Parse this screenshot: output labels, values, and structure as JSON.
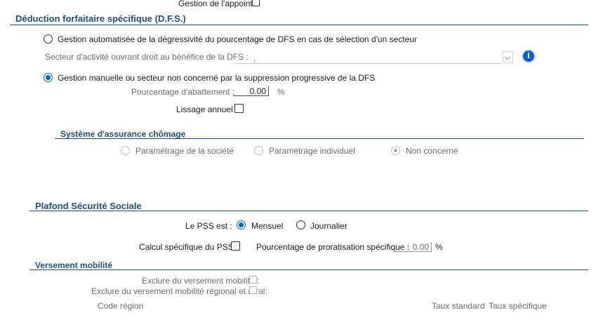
{
  "top": {
    "appoint_label": "Gestion de l'appoint :"
  },
  "dfs": {
    "title": "Déduction forfaitaire spécifique (D.F.S.)",
    "option_auto": "Gestion automatisée de la dégressivité du pourcentage de DFS en cas de sélection d'un secteur",
    "secteur_label": "Secteur d'activité ouvrant droit au bénéfice de la DFS :",
    "secteur_value": "",
    "info_icon": "i",
    "option_manual": "Gestion manuelle ou secteur non concerné par la suppression progressive de la DFS",
    "abattement_label": "Pourcentage d'abattement :",
    "abattement_value": "0.00",
    "abattement_unit": "%",
    "lissage_label": "Lissage annuel :"
  },
  "chomage": {
    "title": "Système d'assurance chômage",
    "options": [
      "Paramétrage de la société",
      "Paramétrage individuel",
      "Non concerné"
    ]
  },
  "pss": {
    "title": "Plafond Sécurité Sociale",
    "pss_label": "Le PSS est :",
    "opt_mensuel": "Mensuel",
    "opt_journalier": "Journalier",
    "calcul_label": "Calcul spécifique du PSS :",
    "proratisation_label": "Pourcentage de proratisation spécifique :",
    "proratisation_value": "0.00",
    "proratisation_unit": "%"
  },
  "mobilite": {
    "title": "Versement mobilité",
    "exclure_label": "Exclure du versement mobilité :",
    "exclure_regional_label": "Exclure du versement mobilité régional et rural:",
    "col_code_region": "Code région",
    "col_taux_standard": "Taux standard",
    "col_taux_specifique": "Taux spécifique"
  },
  "colors": {
    "accent": "#1f4e79",
    "radio_blue": "#0067c0",
    "info_blue": "#0a5fc6"
  }
}
